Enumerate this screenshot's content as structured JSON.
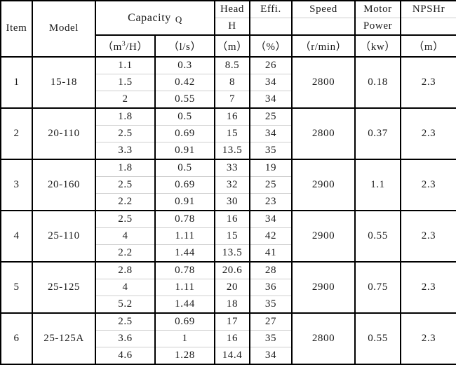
{
  "table": {
    "header": {
      "item": "Item",
      "model": "Model",
      "capacity": "Capacity",
      "capacity_symbol": "Q",
      "capacity_unit_m3h_prefix": "（m",
      "capacity_unit_m3h_exp": "3",
      "capacity_unit_m3h_suffix": "/H）",
      "capacity_unit_ls": "（l/s）",
      "head": "Head",
      "head_symbol": "H",
      "head_unit": "（m）",
      "effi": "Effi.",
      "effi_sub": "",
      "effi_unit": "（%）",
      "speed": "Speed",
      "speed_sub": "",
      "speed_unit": "（r/min）",
      "motor": "Motor",
      "motor_power": "Power",
      "motor_unit": "（kw）",
      "npshr": "NPSHr",
      "npshr_sub": "",
      "npshr_unit": "（m）"
    },
    "columns": [
      "Item",
      "Model",
      "Capacity Q (m3/H)",
      "Capacity Q (l/s)",
      "Head H (m)",
      "Effi. (%)",
      "Speed (r/min)",
      "Motor Power (kw)",
      "NPSHr (m)"
    ],
    "groups": [
      {
        "item": "1",
        "model": "15-18",
        "speed": "2800",
        "motor_power": "0.18",
        "npshr": "2.3",
        "rows": [
          {
            "q_m3h": "1.1",
            "q_ls": "0.3",
            "head": "8.5",
            "effi": "26"
          },
          {
            "q_m3h": "1.5",
            "q_ls": "0.42",
            "head": "8",
            "effi": "34"
          },
          {
            "q_m3h": "2",
            "q_ls": "0.55",
            "head": "7",
            "effi": "34"
          }
        ]
      },
      {
        "item": "2",
        "model": "20-110",
        "speed": "2800",
        "motor_power": "0.37",
        "npshr": "2.3",
        "rows": [
          {
            "q_m3h": "1.8",
            "q_ls": "0.5",
            "head": "16",
            "effi": "25"
          },
          {
            "q_m3h": "2.5",
            "q_ls": "0.69",
            "head": "15",
            "effi": "34"
          },
          {
            "q_m3h": "3.3",
            "q_ls": "0.91",
            "head": "13.5",
            "effi": "35"
          }
        ]
      },
      {
        "item": "3",
        "model": "20-160",
        "speed": "2900",
        "motor_power": "1.1",
        "npshr": "2.3",
        "rows": [
          {
            "q_m3h": "1.8",
            "q_ls": "0.5",
            "head": "33",
            "effi": "19"
          },
          {
            "q_m3h": "2.5",
            "q_ls": "0.69",
            "head": "32",
            "effi": "25"
          },
          {
            "q_m3h": "2.2",
            "q_ls": "0.91",
            "head": "30",
            "effi": "23"
          }
        ]
      },
      {
        "item": "4",
        "model": "25-110",
        "speed": "2900",
        "motor_power": "0.55",
        "npshr": "2.3",
        "rows": [
          {
            "q_m3h": "2.5",
            "q_ls": "0.78",
            "head": "16",
            "effi": "34"
          },
          {
            "q_m3h": "4",
            "q_ls": "1.11",
            "head": "15",
            "effi": "42"
          },
          {
            "q_m3h": "2.2",
            "q_ls": "1.44",
            "head": "13.5",
            "effi": "41"
          }
        ]
      },
      {
        "item": "5",
        "model": "25-125",
        "speed": "2900",
        "motor_power": "0.75",
        "npshr": "2.3",
        "rows": [
          {
            "q_m3h": "2.8",
            "q_ls": "0.78",
            "head": "20.6",
            "effi": "28"
          },
          {
            "q_m3h": "4",
            "q_ls": "1.11",
            "head": "20",
            "effi": "36"
          },
          {
            "q_m3h": "5.2",
            "q_ls": "1.44",
            "head": "18",
            "effi": "35"
          }
        ]
      },
      {
        "item": "6",
        "model": "25-125A",
        "speed": "2800",
        "motor_power": "0.55",
        "npshr": "2.3",
        "rows": [
          {
            "q_m3h": "2.5",
            "q_ls": "0.69",
            "head": "17",
            "effi": "27"
          },
          {
            "q_m3h": "3.6",
            "q_ls": "1",
            "head": "16",
            "effi": "35"
          },
          {
            "q_m3h": "4.6",
            "q_ls": "1.28",
            "head": "14.4",
            "effi": "34"
          }
        ]
      }
    ]
  }
}
